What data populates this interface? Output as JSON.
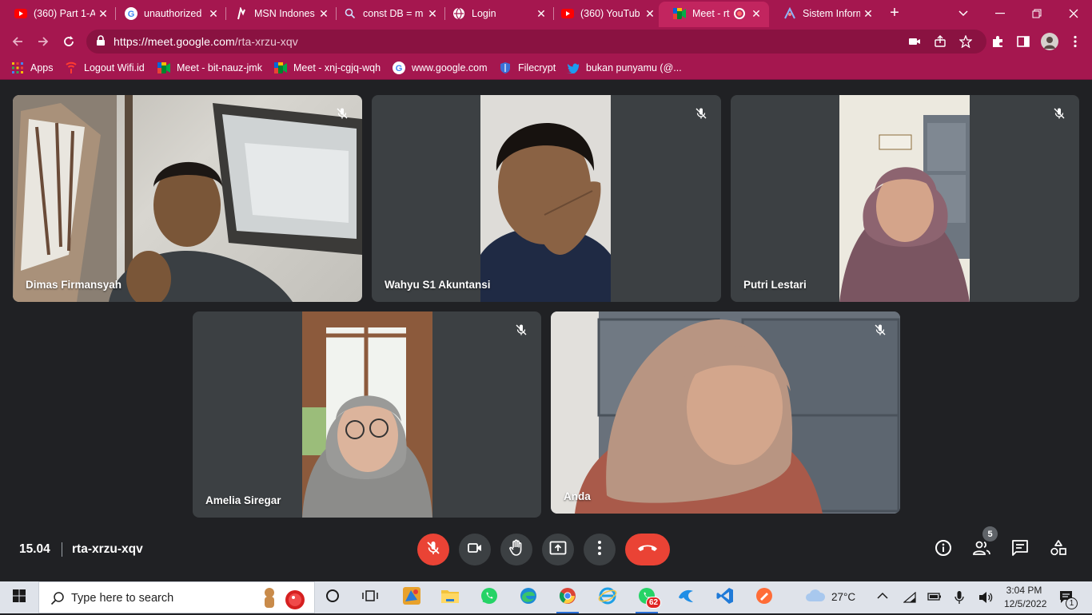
{
  "browser": {
    "tabs": [
      {
        "title": "(360) Part 1-A",
        "icon": "youtube-icon"
      },
      {
        "title": "unauthorized",
        "icon": "google-icon"
      },
      {
        "title": "MSN Indones",
        "icon": "msn-icon"
      },
      {
        "title": "const DB = m",
        "icon": "search-icon"
      },
      {
        "title": "Login",
        "icon": "globe-icon"
      },
      {
        "title": "(360) YouTub",
        "icon": "youtube-icon"
      },
      {
        "title": "Meet - rt",
        "icon": "meet-icon",
        "active": true
      },
      {
        "title": "Sistem Inform",
        "icon": "web-icon"
      }
    ],
    "url_host": "https://meet.google.com",
    "url_path": "/rta-xrzu-xqv",
    "bookmarks": [
      {
        "label": "Apps",
        "icon": "apps-grid-icon"
      },
      {
        "label": "Logout Wifi.id",
        "icon": "wifi-icon"
      },
      {
        "label": "Meet - bit-nauz-jmk",
        "icon": "meet-icon"
      },
      {
        "label": "Meet - xnj-cgjq-wqh",
        "icon": "meet-icon"
      },
      {
        "label": "www.google.com",
        "icon": "google-icon"
      },
      {
        "label": "Filecrypt",
        "icon": "shield-icon"
      },
      {
        "label": "bukan punyamu (@...",
        "icon": "twitter-icon"
      }
    ]
  },
  "meet": {
    "participants": [
      {
        "name": "Dimas Firmansyah",
        "muted": true
      },
      {
        "name": "Wahyu S1 Akuntansi",
        "muted": true
      },
      {
        "name": "Putri Lestari",
        "muted": true
      },
      {
        "name": "Amelia Siregar",
        "muted": true
      },
      {
        "name": "Anda",
        "muted": true
      }
    ],
    "time": "15.04",
    "meeting_code": "rta-xrzu-xqv",
    "people_count": "5"
  },
  "taskbar": {
    "search_placeholder": "Type here to search",
    "whatsapp_badge": "62",
    "weather": "27°C",
    "time": "3:04 PM",
    "date": "12/5/2022",
    "notifications": "1"
  },
  "colors": {
    "chrome_theme": "#a5174f",
    "meet_bg": "#202124",
    "tile_bg": "#3c4043",
    "danger": "#ea4335"
  }
}
